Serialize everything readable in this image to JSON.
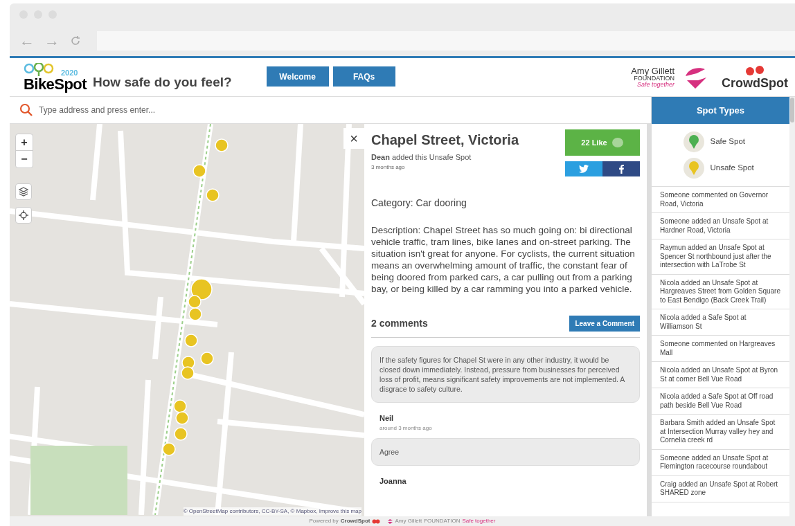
{
  "browser": {
    "back": "←",
    "forward": "→"
  },
  "header": {
    "logo_year": "2020",
    "logo_name": "BikeSpot",
    "tagline": "How safe do you feel?",
    "nav": [
      {
        "label": "Welcome"
      },
      {
        "label": "FAQs"
      }
    ],
    "partner": {
      "name": "Amy Gillett",
      "line2": "FOUNDATION",
      "line3": "Safe together"
    },
    "brand": "CrowdSpot"
  },
  "search": {
    "placeholder": "Type address and press enter..."
  },
  "map": {
    "zoom_in": "+",
    "zoom_out": "−",
    "close": "×",
    "attribution": "© OpenStreetMap contributors, CC-BY-SA, © Mapbox, Improve this map"
  },
  "spot": {
    "title": "Chapel Street, Victoria",
    "author": "Dean",
    "added": "added this Unsafe Spot",
    "time": "3 months ago",
    "likes": "22 Like",
    "category": "Category: Car dooring",
    "description": "Description: Chapel Street has so much going on: bi directional vehicle traffic, tram lines, bike lanes and on-street parking. The situation isn't great for anyone. For cyclists, the current situation means an overwhelming amount of traffic, the constant fear of being doored from parked cars, a car pulling out from a parking bay, or being killed by a car ramming you into a parked vehicle.",
    "comments_heading": "2 comments",
    "comment_button": "Leave a Comment",
    "comments": [
      {
        "text": "If the safety figures for Chapel St were in any other industry, it would be closed down immediately. Instead, pressure from businesses for perceived loss of profit, means significant safety improvements are not implemented. A disgrace to safety culture.",
        "author": "Neil",
        "time": "around 3 months ago"
      },
      {
        "text": "Agree",
        "author": "Joanna"
      }
    ]
  },
  "sidebar": {
    "title": "Spot Types",
    "spot_types": [
      {
        "label": "Safe Spot",
        "color": "#4caf50"
      },
      {
        "label": "Unsafe Spot",
        "color": "#e8c422"
      }
    ],
    "activity": [
      "Someone commented on Governor Road, Victoria",
      "Someone added an Unsafe Spot at Hardner Road, Victoria",
      "Raymun added an Unsafe Spot at Spencer St northbound just after the intersection with LaTrobe St",
      "Nicola added an Unsafe Spot at Hargreaves Street from Golden Square to East Bendigo (Back Creek Trail)",
      "Nicola added a Safe Spot at Williamson St",
      "Someone commented on Hargreaves Mall",
      "Nicola added an Unsafe Spot at Byron St at corner Bell Vue Road",
      "Nicola added a Safe Spot at Off road path beside Bell Vue Road",
      "Barbara Smith added an Unsafe Spot at Intersection Murray valley hey and Cornelia creek rd",
      "Someone added an Unsafe Spot at Flemington racecourse roundabout",
      "Craig added an Unsafe Spot at Robert SHARED zone"
    ]
  },
  "footer": {
    "powered": "Powered by",
    "brand": "CrowdSpot",
    "partner": "Amy Gillett",
    "partner_line2": "FOUNDATION",
    "partner_line3": "Safe together"
  }
}
